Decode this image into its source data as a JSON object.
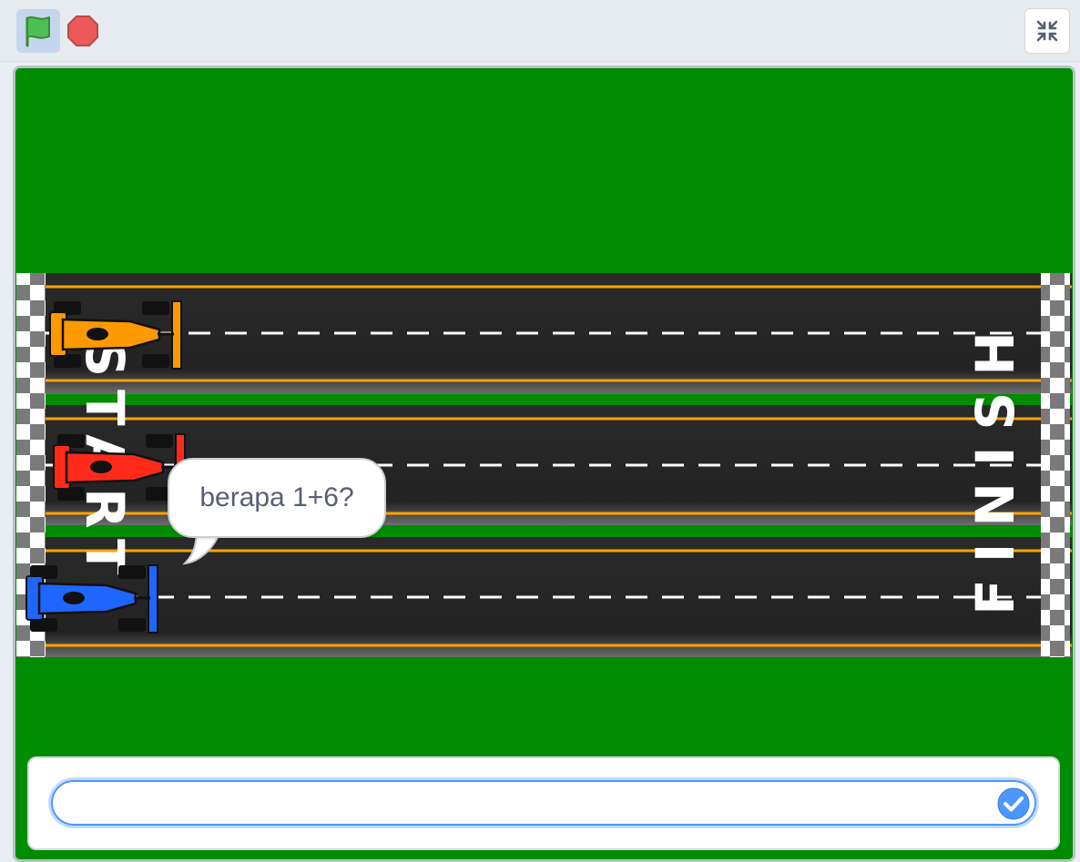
{
  "toolbar": {
    "green_flag_icon": "green-flag-icon",
    "stop_icon": "stop-icon",
    "unfullscreen_icon": "unfullscreen-icon"
  },
  "stage": {
    "start_label": "START",
    "finish_label": "FINISH",
    "speech_bubble": "berapa 1+6?",
    "cars": [
      {
        "name": "orange-car",
        "color": "#ff9900"
      },
      {
        "name": "red-car",
        "color": "#ff2a1a"
      },
      {
        "name": "blue-car",
        "color": "#1f66ff"
      }
    ]
  },
  "ask": {
    "answer_value": "",
    "submit_icon": "check-icon"
  },
  "colors": {
    "grass": "#008c00",
    "asphalt": "#262626",
    "lane_edge": "#ffa200",
    "accent": "#4c97ff"
  }
}
